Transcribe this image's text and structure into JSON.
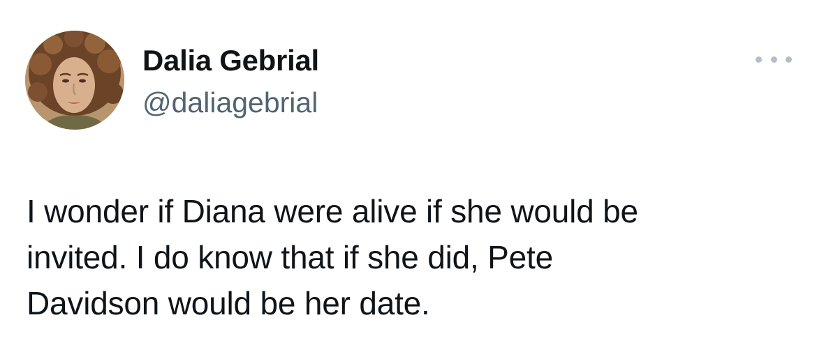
{
  "author": {
    "display_name": "Dalia Gebrial",
    "handle": "@daliagebrial",
    "avatar_icon": "profile-photo"
  },
  "more_menu": {
    "icon": "more-options-icon"
  },
  "tweet": {
    "lines": [
      "I wonder if Diana were alive if she would be",
      "invited. I do know that if she did, Pete",
      "Davidson would be her date."
    ]
  },
  "colors": {
    "text_primary": "#0f1419",
    "text_secondary": "#536471",
    "icon_muted": "#b4bec7",
    "background": "#ffffff"
  }
}
